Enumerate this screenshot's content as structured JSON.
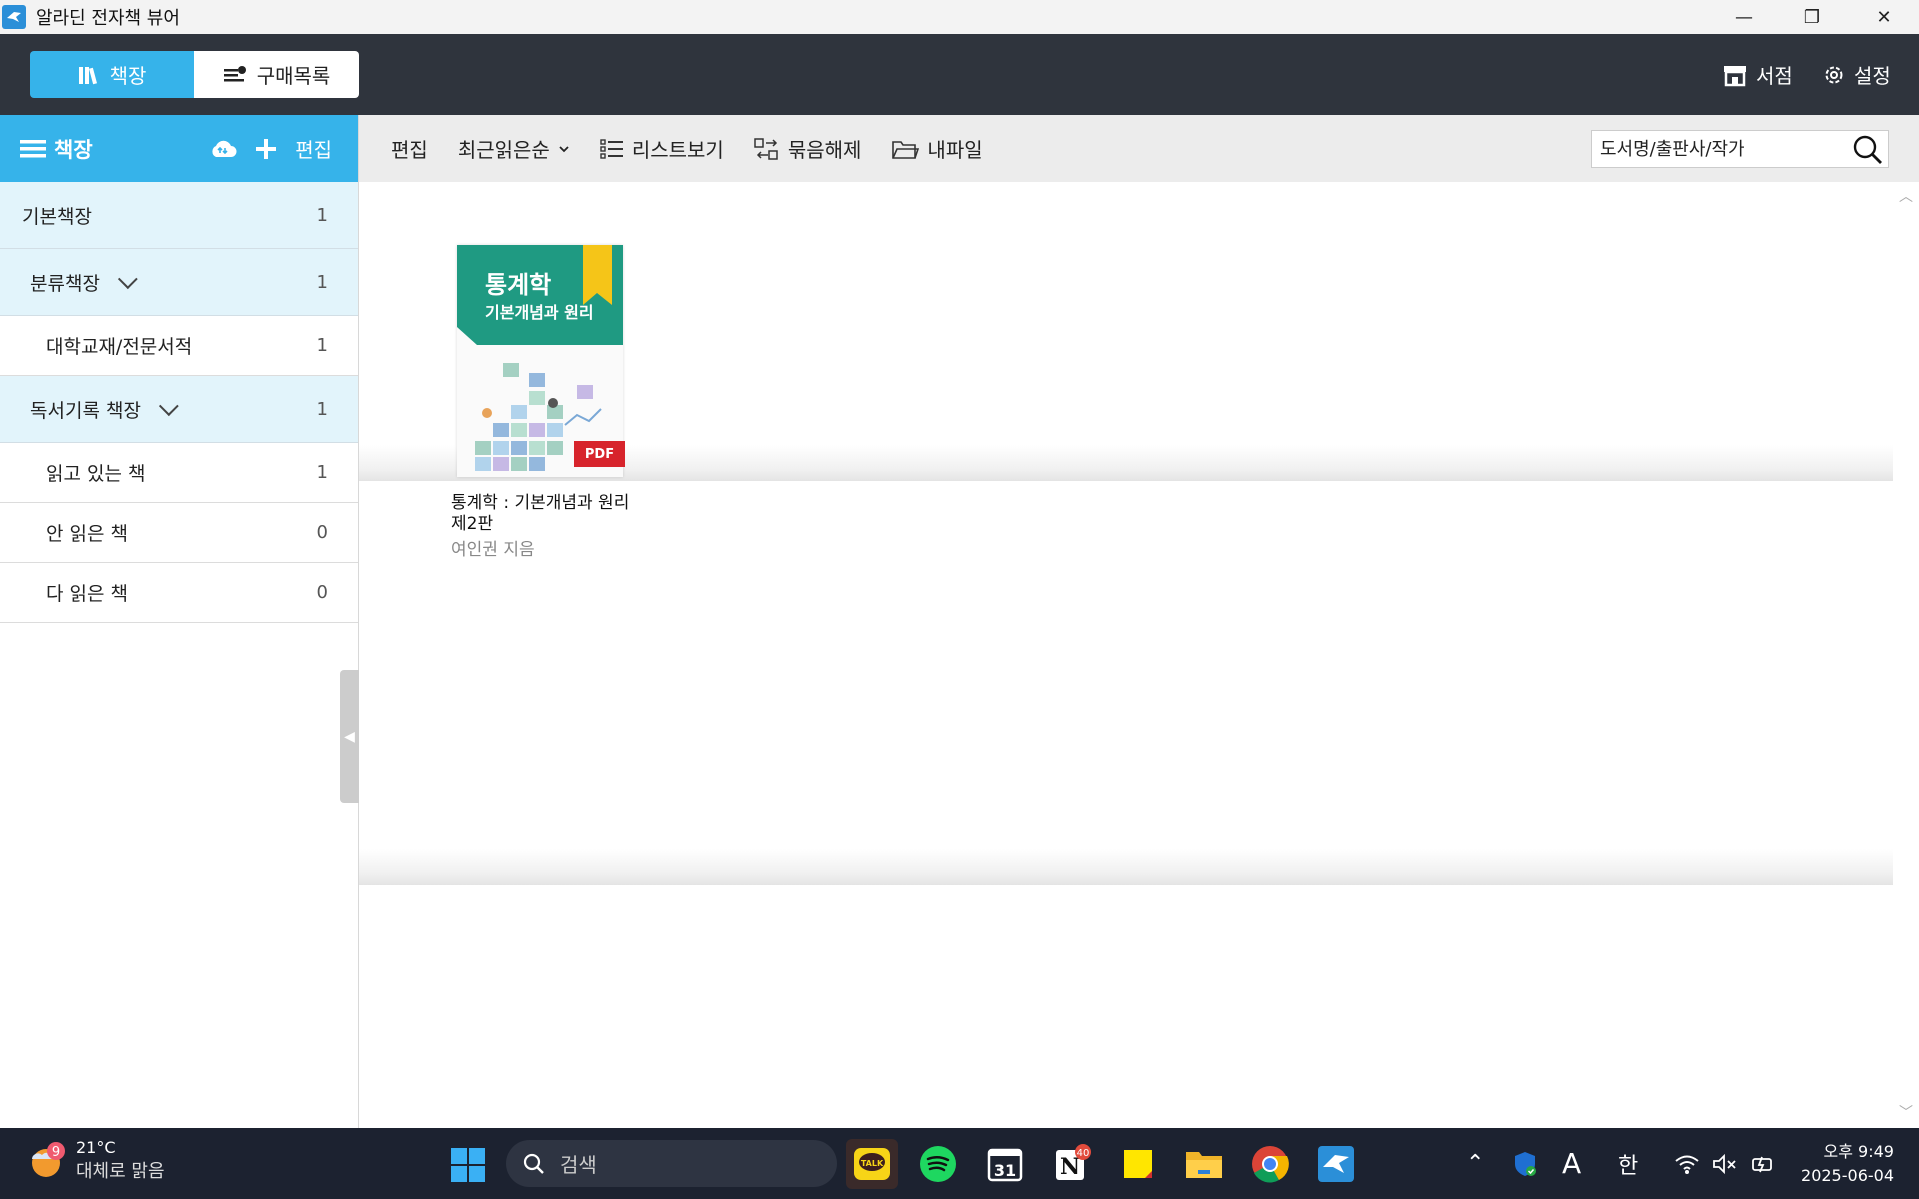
{
  "window": {
    "title": "알라딘 전자책 뷰어",
    "minimize_glyph": "—",
    "restore_glyph": "❐",
    "close_glyph": "✕"
  },
  "topnav": {
    "tab_bookshelf": "책장",
    "tab_purchases": "구매목록",
    "store": "서점",
    "settings": "설정"
  },
  "sidebar": {
    "header_label": "책장",
    "edit_label": "편집",
    "shelves": [
      {
        "label": "기본책장",
        "count": "1"
      },
      {
        "label": "분류책장",
        "count": "1"
      },
      {
        "label": "대학교재/전문서적",
        "count": "1"
      },
      {
        "label": "독서기록 책장",
        "count": "1"
      },
      {
        "label": "읽고 있는 책",
        "count": "1"
      },
      {
        "label": "안 읽은 책",
        "count": "0"
      },
      {
        "label": "다 읽은 책",
        "count": "0"
      }
    ]
  },
  "toolbar": {
    "edit": "편집",
    "sort": "최근읽은순",
    "list_view": "리스트보기",
    "ungroup": "묶음해제",
    "my_files": "내파일",
    "search_placeholder": "도서명/출판사/작가"
  },
  "book": {
    "cover_title_line1": "통계학",
    "cover_title_line2": "기본개념과 원리",
    "badge": "PDF",
    "title": "통계학 : 기본개념과 원리 제2판",
    "author": "여인권 지음"
  },
  "taskbar": {
    "weather_badge": "9",
    "temperature": "21°C",
    "condition": "대체로 맑음",
    "search_label": "검색",
    "notion_badge": "40",
    "calendar_day": "31",
    "ime_letter": "A",
    "ime_korean": "한",
    "time": "오후 9:49",
    "date": "2025-06-04"
  },
  "colors": {
    "accent": "#36b3ea",
    "topnav_bg": "#2f343d",
    "taskbar_bg": "#1c2230",
    "pdf_badge": "#d7242c",
    "cover_green": "#1f9a82",
    "bookmark_yellow": "#f5c518"
  }
}
